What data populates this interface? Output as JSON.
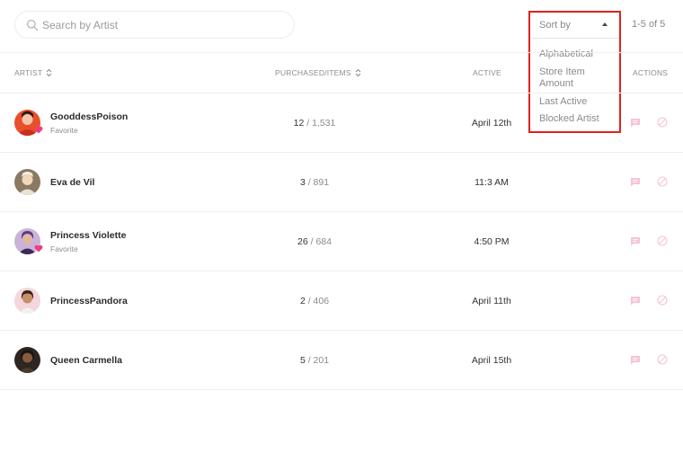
{
  "search": {
    "placeholder": "Search by Artist",
    "value": "",
    "icon": "search-icon"
  },
  "sort": {
    "label": "Sort by",
    "options": [
      "Alphabetical",
      "Store Item Amount",
      "Last Active",
      "Blocked Artist"
    ]
  },
  "pager": {
    "text": "1-5 of 5"
  },
  "columns": {
    "artist": "ARTIST",
    "purchased": "PURCHASED/ITEMS",
    "active": "ACTIVE",
    "actions": "ACTIONS"
  },
  "colors": {
    "heart": "#ee3c82",
    "action_icon": "#f6c4d4",
    "highlight": "#e0221b"
  },
  "rows": [
    {
      "name": "GooddessPoison",
      "sub": "Favorite",
      "favorite": true,
      "purchased": "12",
      "total": "/ 1,531",
      "active": "April 12th"
    },
    {
      "name": "Eva de Vil",
      "sub": "",
      "favorite": false,
      "purchased": "3",
      "total": "/ 891",
      "active": "11:3 AM"
    },
    {
      "name": "Princess Violette",
      "sub": "Favorite",
      "favorite": true,
      "purchased": "26",
      "total": "/ 684",
      "active": "4:50 PM"
    },
    {
      "name": "PrincessPandora",
      "sub": "",
      "favorite": false,
      "purchased": "2",
      "total": "/ 406",
      "active": "April 11th"
    },
    {
      "name": "Queen Carmella",
      "sub": "",
      "favorite": false,
      "purchased": "5",
      "total": "/ 201",
      "active": "April 15th"
    }
  ]
}
